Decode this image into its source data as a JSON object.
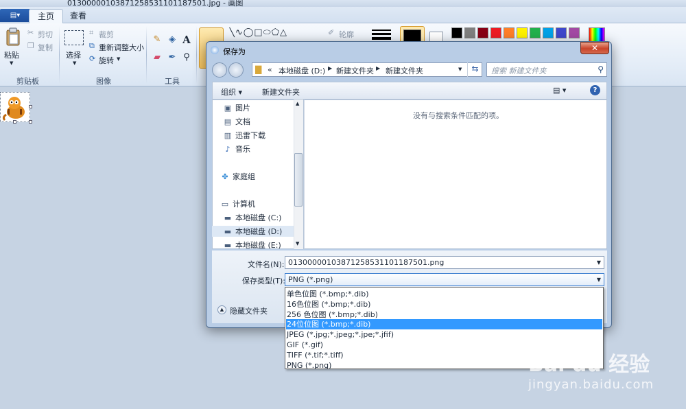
{
  "window": {
    "title": "01300000103871258531101187501.jpg - 画图"
  },
  "tabs": {
    "menu_label": "▤▾",
    "home": "主页",
    "view": "查看"
  },
  "ribbon": {
    "clipboard": {
      "paste": "粘贴",
      "cut": "剪切",
      "copy": "复制",
      "label": "剪贴板"
    },
    "image": {
      "select": "选择",
      "crop": "裁剪",
      "resize": "重新调整大小",
      "rotate": "旋转",
      "label": "图像"
    },
    "tools": {
      "label": "工具"
    },
    "shapes": {
      "outline": "轮廓"
    },
    "colors": {
      "row1": [
        "#000000",
        "#7f7f7f",
        "#880015",
        "#ed1c24",
        "#ff7f27",
        "#fff200",
        "#22b14c",
        "#00a2e8",
        "#3f48cc",
        "#a349a4"
      ],
      "color1": "#000000"
    }
  },
  "dialog": {
    "title": "保存为",
    "address": {
      "prefix": "«",
      "parts": [
        "本地磁盘 (D:)",
        "新建文件夹",
        "新建文件夹"
      ]
    },
    "search_placeholder": "搜索 新建文件夹",
    "toolbar": {
      "organize": "组织 ▾",
      "new_folder": "新建文件夹"
    },
    "nav": [
      {
        "icon": "pictures-icon",
        "glyph": "▣",
        "label": "图片"
      },
      {
        "icon": "documents-icon",
        "glyph": "▤",
        "label": "文档"
      },
      {
        "icon": "download-icon",
        "glyph": "▥",
        "label": "迅雷下载"
      },
      {
        "icon": "music-icon",
        "glyph": "♪",
        "label": "音乐"
      },
      {
        "icon": "homegroup-icon",
        "glyph": "✤",
        "label": "家庭组"
      },
      {
        "icon": "computer-icon",
        "glyph": "▭",
        "label": "计算机"
      },
      {
        "icon": "drive-icon",
        "glyph": "▬",
        "label": "本地磁盘 (C:)"
      },
      {
        "icon": "drive-icon",
        "glyph": "▬",
        "label": "本地磁盘 (D:)"
      },
      {
        "icon": "drive-icon",
        "glyph": "▬",
        "label": "本地磁盘 (E:)"
      }
    ],
    "empty_message": "没有与搜索条件匹配的项。",
    "filename_label": "文件名(N):",
    "filename_value": "01300000103871258531101187501.png",
    "type_label": "保存类型(T):",
    "type_value": "PNG (*.png)",
    "hide_folders": "隐藏文件夹",
    "type_options": [
      "单色位图 (*.bmp;*.dib)",
      "16色位图 (*.bmp;*.dib)",
      "256 色位图 (*.bmp;*.dib)",
      "24位位图 (*.bmp;*.dib)",
      "JPEG (*.jpg;*.jpeg;*.jpe;*.jfif)",
      "GIF (*.gif)",
      "TIFF (*.tif;*.tiff)",
      "PNG (*.png)"
    ],
    "selected_option": 3
  },
  "watermark": {
    "brand": "Bai du 经验",
    "url": "jingyan.baidu.com"
  }
}
